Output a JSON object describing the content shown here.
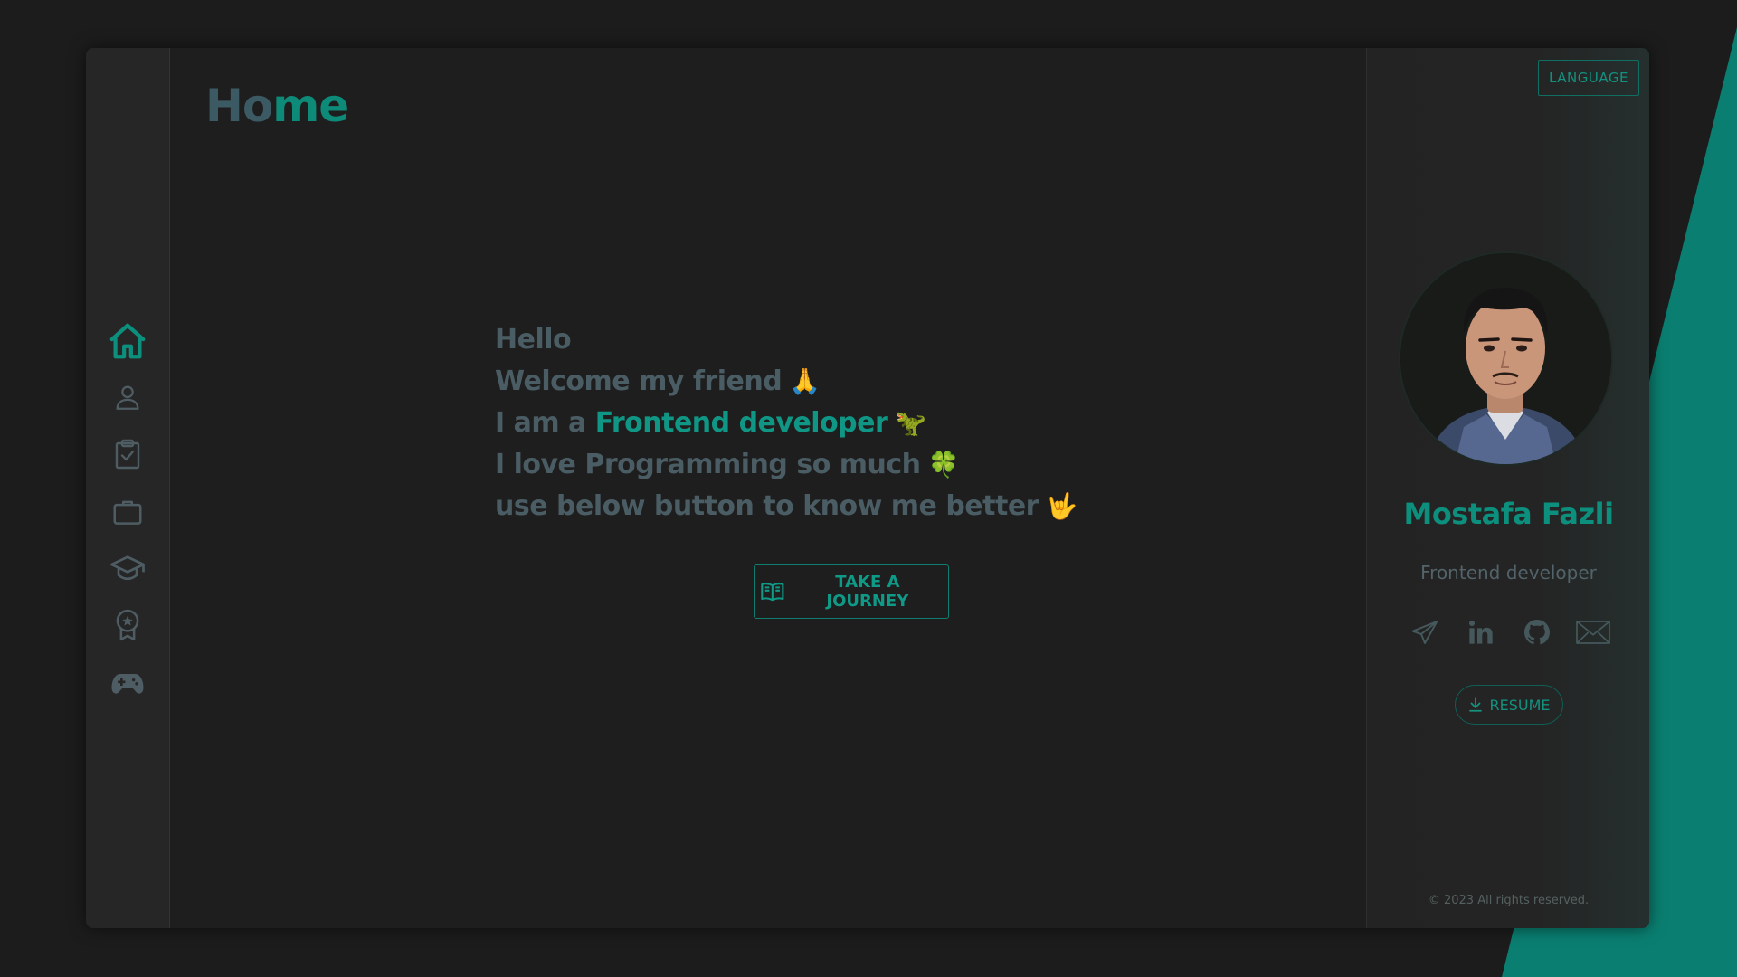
{
  "page": {
    "title_part_a": "Ho",
    "title_part_b": "me"
  },
  "sidebar": {
    "items": [
      {
        "icon": "home-icon",
        "active": true
      },
      {
        "icon": "user-icon",
        "active": false
      },
      {
        "icon": "clipboard-check-icon",
        "active": false
      },
      {
        "icon": "briefcase-icon",
        "active": false
      },
      {
        "icon": "graduation-cap-icon",
        "active": false
      },
      {
        "icon": "award-icon",
        "active": false
      },
      {
        "icon": "gamepad-icon",
        "active": false
      }
    ]
  },
  "intro": {
    "line1": "Hello",
    "line2": "Welcome my friend",
    "line2_emoji": "🙏",
    "line3_prefix": "I am a",
    "line3_accent": "Frontend developer",
    "line3_emoji": "🦖",
    "line4": "I love Programming so much",
    "line4_emoji": "🍀",
    "line5": "use below button to know me better",
    "line5_emoji": "🤟"
  },
  "journey_button": {
    "label": "TAKE A JOURNEY",
    "icon": "open-book-icon"
  },
  "profile": {
    "language_label": "LANGUAGE",
    "name": "Mostafa Fazli",
    "role": "Frontend developer",
    "socials": [
      {
        "icon": "telegram-icon"
      },
      {
        "icon": "linkedin-icon"
      },
      {
        "icon": "github-icon"
      },
      {
        "icon": "mail-icon"
      }
    ],
    "resume_label": "RESUME",
    "copyright": "© 2023 All rights reserved."
  },
  "colors": {
    "accent": "#0d8f7d",
    "background": "#1c1c1c",
    "muted_text": "#4b5d64"
  }
}
